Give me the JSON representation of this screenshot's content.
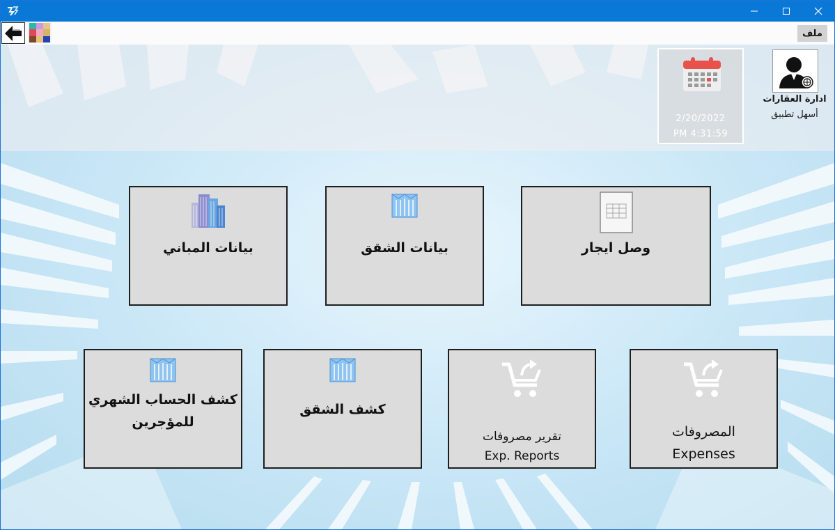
{
  "toolbar": {
    "file_label": "ملف"
  },
  "profile": {
    "title": "ادارة العقارات",
    "subtitle": "أسهل تطبيق"
  },
  "datetime": {
    "date": "2/20/2022",
    "time": "PM 4:31:59"
  },
  "tiles": {
    "buildings": {
      "label": "بيانات المباني",
      "icon": "buildings-icon"
    },
    "apartments": {
      "label": "بيانات الشقق",
      "icon": "apartment-building-icon"
    },
    "receipt": {
      "label": "وصل ايجار",
      "icon": "document-table-icon"
    },
    "tenant_statement": {
      "label_line1": "كشف الحساب الشهري",
      "label_line2": "للمؤجرين",
      "icon": "apartment-building-icon"
    },
    "apartment_statement": {
      "label": "كشف الشقق",
      "icon": "apartment-building-icon"
    },
    "expense_reports": {
      "label_line1": "تقرير مصروفات",
      "label_line2": "Exp. Reports",
      "icon": "cart-arrow-icon"
    },
    "expenses": {
      "label_line1": "المصروفات",
      "label_line2": "Expenses",
      "icon": "cart-arrow-icon"
    }
  },
  "colors": {
    "titlebar": "#0a78d7",
    "tile_bg": "#dcdcdc",
    "tile_border": "#1e1e1e",
    "calendar_red": "#e8524a"
  }
}
